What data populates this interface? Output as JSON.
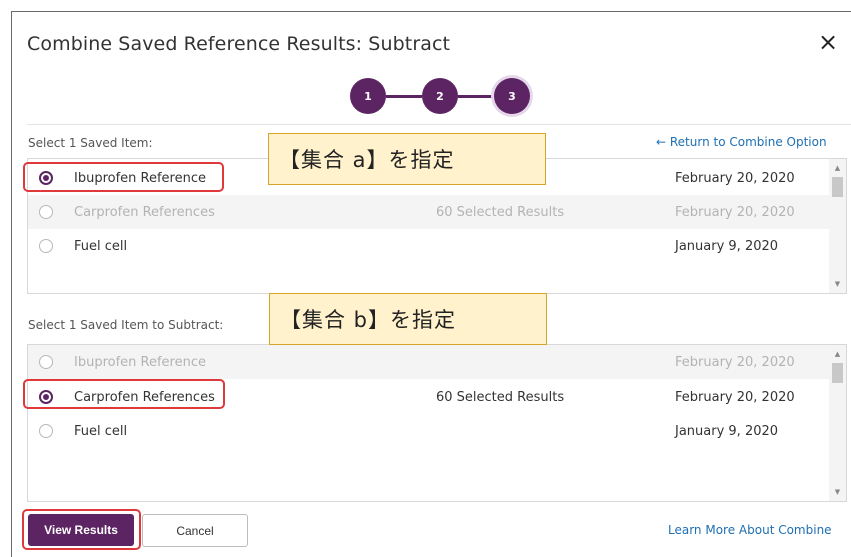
{
  "dialog": {
    "title": "Combine Saved Reference Results: Subtract",
    "close_icon": "×",
    "steps": [
      "1",
      "2",
      "3"
    ],
    "return_link": "← Return to Combine Option"
  },
  "section_a": {
    "label": "Select 1 Saved Item:",
    "callout": "【集合 a】を指定",
    "rows": [
      {
        "name": "Ibuprofen Reference",
        "count": "",
        "date": "February 20, 2020",
        "state": "checked"
      },
      {
        "name": "Carprofen References",
        "count": "60 Selected Results",
        "date": "February 20, 2020",
        "state": "disabled"
      },
      {
        "name": "Fuel cell",
        "count": "",
        "date": "January 9, 2020",
        "state": "enabled"
      }
    ]
  },
  "section_b": {
    "label": "Select 1 Saved Item to Subtract:",
    "callout": "【集合 b】を指定",
    "rows": [
      {
        "name": "Ibuprofen Reference",
        "count": "",
        "date": "February 20, 2020",
        "state": "disabled"
      },
      {
        "name": "Carprofen References",
        "count": "60 Selected Results",
        "date": "February 20, 2020",
        "state": "checked"
      },
      {
        "name": "Fuel cell",
        "count": "",
        "date": "January 9, 2020",
        "state": "enabled"
      }
    ]
  },
  "footer": {
    "view_results": "View Results",
    "cancel": "Cancel",
    "learn_more": "Learn More About Combine"
  },
  "colors": {
    "accent": "#5c2463",
    "link": "#1f6fb2",
    "highlight": "#e0393b",
    "callout_fill": "#fff2cc"
  }
}
